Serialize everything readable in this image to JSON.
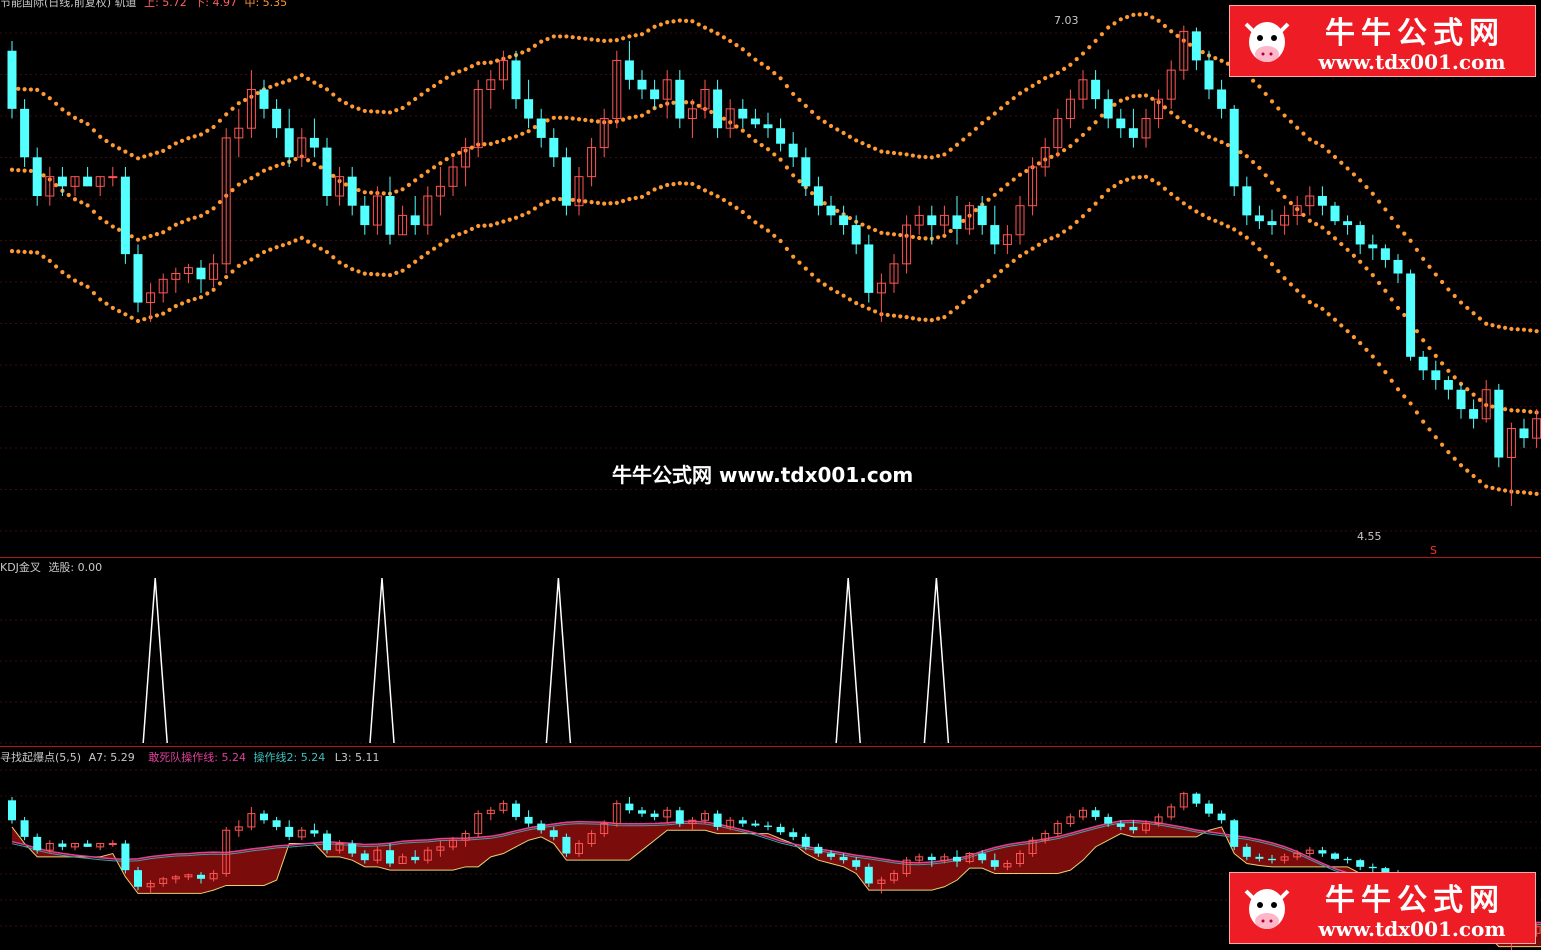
{
  "top_panel": {
    "title": "节能国际(日线,前复权) 轨道",
    "up_label": "上: 5.72",
    "down_label": "下: 4.97",
    "mid_label": "中: 5.35",
    "high_marker": "7.03",
    "low_marker": "4.55",
    "price_range": [
      4.4,
      7.1
    ]
  },
  "kdj_panel": {
    "title": "KDJ金叉",
    "select_label": "选股: 0.00"
  },
  "bottom_panel": {
    "title": "寻找起爆点(5,5)",
    "a7_label": "A7: 5.29",
    "line1_label": "敢死队操作线: 5.24",
    "line2_label": "操作线2: 5.24",
    "l3_label": "L3: 5.11"
  },
  "watermark": {
    "center_text": "牛牛公式网 www.tdx001.com",
    "badge_name": "牛牛公式网",
    "badge_url": "www.tdx001.com"
  },
  "colors": {
    "up": "#ff5555",
    "down": "#54ffff",
    "band": "#ff9933",
    "panel_border": "#b01818",
    "pink_line": "#e0409a",
    "dark_fill": "#7a0c0c"
  },
  "chart_data": [
    {
      "type": "candlestick",
      "title": "节能国际(日线,前复权) 轨道",
      "ylim": [
        4.4,
        7.1
      ],
      "series": [
        {
          "name": "K",
          "values": [
            [
              6.9,
              6.95,
              6.55,
              6.6
            ],
            [
              6.6,
              6.65,
              6.3,
              6.35
            ],
            [
              6.35,
              6.4,
              6.1,
              6.15
            ],
            [
              6.15,
              6.3,
              6.1,
              6.25
            ],
            [
              6.25,
              6.3,
              6.15,
              6.2
            ],
            [
              6.2,
              6.25,
              6.15,
              6.25
            ],
            [
              6.25,
              6.3,
              6.2,
              6.2
            ],
            [
              6.2,
              6.25,
              6.15,
              6.25
            ],
            [
              6.25,
              6.3,
              6.2,
              6.25
            ],
            [
              6.25,
              6.3,
              5.8,
              5.85
            ],
            [
              5.85,
              5.9,
              5.55,
              5.6
            ],
            [
              5.6,
              5.7,
              5.5,
              5.65
            ],
            [
              5.65,
              5.75,
              5.6,
              5.72
            ],
            [
              5.72,
              5.78,
              5.65,
              5.75
            ],
            [
              5.75,
              5.8,
              5.7,
              5.78
            ],
            [
              5.78,
              5.82,
              5.65,
              5.72
            ],
            [
              5.72,
              5.85,
              5.68,
              5.8
            ],
            [
              5.8,
              6.5,
              5.75,
              6.45
            ],
            [
              6.45,
              6.6,
              6.35,
              6.5
            ],
            [
              6.5,
              6.8,
              6.45,
              6.7
            ],
            [
              6.7,
              6.75,
              6.55,
              6.6
            ],
            [
              6.6,
              6.65,
              6.45,
              6.5
            ],
            [
              6.5,
              6.6,
              6.3,
              6.35
            ],
            [
              6.35,
              6.5,
              6.3,
              6.45
            ],
            [
              6.45,
              6.55,
              6.35,
              6.4
            ],
            [
              6.4,
              6.45,
              6.1,
              6.15
            ],
            [
              6.15,
              6.3,
              6.1,
              6.25
            ],
            [
              6.25,
              6.3,
              6.05,
              6.1
            ],
            [
              6.1,
              6.15,
              5.95,
              6.0
            ],
            [
              6.0,
              6.2,
              5.95,
              6.15
            ],
            [
              6.15,
              6.25,
              5.9,
              5.95
            ],
            [
              5.95,
              6.1,
              5.95,
              6.05
            ],
            [
              6.05,
              6.15,
              5.95,
              6.0
            ],
            [
              6.0,
              6.2,
              5.95,
              6.15
            ],
            [
              6.15,
              6.3,
              6.05,
              6.2
            ],
            [
              6.2,
              6.35,
              6.15,
              6.3
            ],
            [
              6.3,
              6.45,
              6.2,
              6.4
            ],
            [
              6.4,
              6.75,
              6.35,
              6.7
            ],
            [
              6.7,
              6.8,
              6.6,
              6.75
            ],
            [
              6.75,
              6.9,
              6.7,
              6.85
            ],
            [
              6.85,
              6.9,
              6.6,
              6.65
            ],
            [
              6.65,
              6.75,
              6.5,
              6.55
            ],
            [
              6.55,
              6.6,
              6.4,
              6.45
            ],
            [
              6.45,
              6.5,
              6.3,
              6.35
            ],
            [
              6.35,
              6.4,
              6.05,
              6.1
            ],
            [
              6.1,
              6.3,
              6.05,
              6.25
            ],
            [
              6.25,
              6.45,
              6.2,
              6.4
            ],
            [
              6.4,
              6.6,
              6.35,
              6.55
            ],
            [
              6.55,
              6.9,
              6.5,
              6.85
            ],
            [
              6.85,
              6.95,
              6.7,
              6.75
            ],
            [
              6.75,
              6.8,
              6.65,
              6.7
            ],
            [
              6.7,
              6.75,
              6.6,
              6.65
            ],
            [
              6.65,
              6.8,
              6.55,
              6.75
            ],
            [
              6.75,
              6.8,
              6.5,
              6.55
            ],
            [
              6.55,
              6.65,
              6.45,
              6.6
            ],
            [
              6.6,
              6.75,
              6.55,
              6.7
            ],
            [
              6.7,
              6.75,
              6.45,
              6.5
            ],
            [
              6.5,
              6.65,
              6.45,
              6.6
            ],
            [
              6.6,
              6.65,
              6.5,
              6.55
            ],
            [
              6.55,
              6.6,
              6.5,
              6.52
            ],
            [
              6.52,
              6.58,
              6.45,
              6.5
            ],
            [
              6.5,
              6.55,
              6.38,
              6.42
            ],
            [
              6.42,
              6.48,
              6.3,
              6.35
            ],
            [
              6.35,
              6.4,
              6.15,
              6.2
            ],
            [
              6.2,
              6.25,
              6.05,
              6.1
            ],
            [
              6.1,
              6.15,
              6.0,
              6.05
            ],
            [
              6.05,
              6.1,
              5.95,
              6.0
            ],
            [
              6.0,
              6.05,
              5.85,
              5.9
            ],
            [
              5.9,
              5.95,
              5.6,
              5.65
            ],
            [
              5.65,
              5.75,
              5.5,
              5.7
            ],
            [
              5.7,
              5.85,
              5.65,
              5.8
            ],
            [
              5.8,
              6.05,
              5.75,
              6.0
            ],
            [
              6.0,
              6.1,
              5.95,
              6.05
            ],
            [
              6.05,
              6.1,
              5.9,
              6.0
            ],
            [
              6.0,
              6.1,
              5.95,
              6.05
            ],
            [
              6.05,
              6.15,
              5.9,
              5.98
            ],
            [
              5.98,
              6.12,
              5.95,
              6.1
            ],
            [
              6.1,
              6.15,
              5.95,
              6.0
            ],
            [
              6.0,
              6.1,
              5.85,
              5.9
            ],
            [
              5.9,
              6.0,
              5.85,
              5.95
            ],
            [
              5.95,
              6.15,
              5.9,
              6.1
            ],
            [
              6.1,
              6.35,
              6.05,
              6.3
            ],
            [
              6.3,
              6.45,
              6.25,
              6.4
            ],
            [
              6.4,
              6.6,
              6.35,
              6.55
            ],
            [
              6.55,
              6.7,
              6.5,
              6.65
            ],
            [
              6.65,
              6.8,
              6.6,
              6.75
            ],
            [
              6.75,
              6.8,
              6.6,
              6.65
            ],
            [
              6.65,
              6.7,
              6.5,
              6.55
            ],
            [
              6.55,
              6.6,
              6.45,
              6.5
            ],
            [
              6.5,
              6.6,
              6.4,
              6.45
            ],
            [
              6.45,
              6.6,
              6.4,
              6.55
            ],
            [
              6.55,
              6.7,
              6.5,
              6.65
            ],
            [
              6.65,
              6.85,
              6.6,
              6.8
            ],
            [
              6.8,
              7.03,
              6.75,
              7.0
            ],
            [
              7.0,
              7.02,
              6.8,
              6.85
            ],
            [
              6.85,
              6.9,
              6.65,
              6.7
            ],
            [
              6.7,
              6.75,
              6.55,
              6.6
            ],
            [
              6.6,
              6.62,
              6.15,
              6.2
            ],
            [
              6.2,
              6.25,
              6.0,
              6.05
            ],
            [
              6.05,
              6.1,
              5.98,
              6.02
            ],
            [
              6.02,
              6.08,
              5.95,
              6.0
            ],
            [
              6.0,
              6.1,
              5.95,
              6.05
            ],
            [
              6.05,
              6.15,
              6.0,
              6.1
            ],
            [
              6.1,
              6.2,
              6.05,
              6.15
            ],
            [
              6.15,
              6.2,
              6.05,
              6.1
            ],
            [
              6.1,
              6.12,
              6.0,
              6.02
            ],
            [
              6.02,
              6.05,
              5.95,
              6.0
            ],
            [
              6.0,
              6.02,
              5.85,
              5.9
            ],
            [
              5.9,
              5.95,
              5.82,
              5.88
            ],
            [
              5.88,
              5.9,
              5.78,
              5.82
            ],
            [
              5.82,
              5.85,
              5.7,
              5.75
            ],
            [
              5.75,
              5.77,
              5.3,
              5.32
            ],
            [
              5.32,
              5.35,
              5.2,
              5.25
            ],
            [
              5.25,
              5.3,
              5.15,
              5.2
            ],
            [
              5.2,
              5.22,
              5.1,
              5.15
            ],
            [
              5.15,
              5.18,
              5.0,
              5.05
            ],
            [
              5.05,
              5.1,
              4.95,
              5.0
            ],
            [
              5.0,
              5.2,
              4.98,
              5.15
            ],
            [
              5.15,
              5.18,
              4.75,
              4.8
            ],
            [
              4.8,
              4.98,
              4.55,
              4.95
            ],
            [
              4.95,
              5.0,
              4.85,
              4.9
            ],
            [
              4.9,
              5.05,
              4.85,
              5.0
            ],
            [
              5.0,
              5.15,
              4.95,
              5.1
            ],
            [
              5.1,
              5.15,
              5.0,
              5.05
            ],
            [
              5.05,
              5.15,
              5.0,
              5.12
            ],
            [
              5.12,
              5.16,
              5.05,
              5.1
            ],
            [
              5.1,
              5.15,
              5.05,
              5.15
            ],
            [
              5.15,
              5.18,
              5.02,
              5.05
            ],
            [
              5.05,
              5.2,
              4.95,
              5.1
            ],
            [
              5.1,
              5.25,
              5.05,
              5.22
            ],
            [
              5.22,
              5.28,
              5.12,
              5.15
            ],
            [
              5.15,
              5.2,
              5.1,
              5.18
            ],
            [
              5.18,
              5.25,
              5.12,
              5.22
            ],
            [
              5.22,
              5.4,
              5.18,
              5.38
            ],
            [
              5.38,
              5.6,
              5.35,
              5.55
            ],
            [
              5.55,
              5.6,
              5.4,
              5.42
            ],
            [
              5.42,
              5.45,
              5.35,
              5.4
            ],
            [
              5.4,
              5.42,
              5.3,
              5.38
            ]
          ]
        }
      ]
    },
    {
      "type": "line",
      "title": "KDJ金叉",
      "x": [
        12,
        30,
        44,
        67,
        74
      ],
      "values": [
        1,
        1,
        1,
        1,
        1
      ]
    }
  ]
}
